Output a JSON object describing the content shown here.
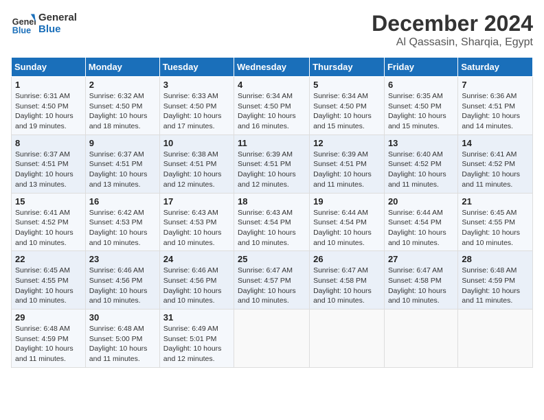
{
  "logo": {
    "line1": "General",
    "line2": "Blue"
  },
  "title": "December 2024",
  "location": "Al Qassasin, Sharqia, Egypt",
  "weekdays": [
    "Sunday",
    "Monday",
    "Tuesday",
    "Wednesday",
    "Thursday",
    "Friday",
    "Saturday"
  ],
  "weeks": [
    [
      {
        "day": "1",
        "info": "Sunrise: 6:31 AM\nSunset: 4:50 PM\nDaylight: 10 hours\nand 19 minutes."
      },
      {
        "day": "2",
        "info": "Sunrise: 6:32 AM\nSunset: 4:50 PM\nDaylight: 10 hours\nand 18 minutes."
      },
      {
        "day": "3",
        "info": "Sunrise: 6:33 AM\nSunset: 4:50 PM\nDaylight: 10 hours\nand 17 minutes."
      },
      {
        "day": "4",
        "info": "Sunrise: 6:34 AM\nSunset: 4:50 PM\nDaylight: 10 hours\nand 16 minutes."
      },
      {
        "day": "5",
        "info": "Sunrise: 6:34 AM\nSunset: 4:50 PM\nDaylight: 10 hours\nand 15 minutes."
      },
      {
        "day": "6",
        "info": "Sunrise: 6:35 AM\nSunset: 4:50 PM\nDaylight: 10 hours\nand 15 minutes."
      },
      {
        "day": "7",
        "info": "Sunrise: 6:36 AM\nSunset: 4:51 PM\nDaylight: 10 hours\nand 14 minutes."
      }
    ],
    [
      {
        "day": "8",
        "info": "Sunrise: 6:37 AM\nSunset: 4:51 PM\nDaylight: 10 hours\nand 13 minutes."
      },
      {
        "day": "9",
        "info": "Sunrise: 6:37 AM\nSunset: 4:51 PM\nDaylight: 10 hours\nand 13 minutes."
      },
      {
        "day": "10",
        "info": "Sunrise: 6:38 AM\nSunset: 4:51 PM\nDaylight: 10 hours\nand 12 minutes."
      },
      {
        "day": "11",
        "info": "Sunrise: 6:39 AM\nSunset: 4:51 PM\nDaylight: 10 hours\nand 12 minutes."
      },
      {
        "day": "12",
        "info": "Sunrise: 6:39 AM\nSunset: 4:51 PM\nDaylight: 10 hours\nand 11 minutes."
      },
      {
        "day": "13",
        "info": "Sunrise: 6:40 AM\nSunset: 4:52 PM\nDaylight: 10 hours\nand 11 minutes."
      },
      {
        "day": "14",
        "info": "Sunrise: 6:41 AM\nSunset: 4:52 PM\nDaylight: 10 hours\nand 11 minutes."
      }
    ],
    [
      {
        "day": "15",
        "info": "Sunrise: 6:41 AM\nSunset: 4:52 PM\nDaylight: 10 hours\nand 10 minutes."
      },
      {
        "day": "16",
        "info": "Sunrise: 6:42 AM\nSunset: 4:53 PM\nDaylight: 10 hours\nand 10 minutes."
      },
      {
        "day": "17",
        "info": "Sunrise: 6:43 AM\nSunset: 4:53 PM\nDaylight: 10 hours\nand 10 minutes."
      },
      {
        "day": "18",
        "info": "Sunrise: 6:43 AM\nSunset: 4:54 PM\nDaylight: 10 hours\nand 10 minutes."
      },
      {
        "day": "19",
        "info": "Sunrise: 6:44 AM\nSunset: 4:54 PM\nDaylight: 10 hours\nand 10 minutes."
      },
      {
        "day": "20",
        "info": "Sunrise: 6:44 AM\nSunset: 4:54 PM\nDaylight: 10 hours\nand 10 minutes."
      },
      {
        "day": "21",
        "info": "Sunrise: 6:45 AM\nSunset: 4:55 PM\nDaylight: 10 hours\nand 10 minutes."
      }
    ],
    [
      {
        "day": "22",
        "info": "Sunrise: 6:45 AM\nSunset: 4:55 PM\nDaylight: 10 hours\nand 10 minutes."
      },
      {
        "day": "23",
        "info": "Sunrise: 6:46 AM\nSunset: 4:56 PM\nDaylight: 10 hours\nand 10 minutes."
      },
      {
        "day": "24",
        "info": "Sunrise: 6:46 AM\nSunset: 4:56 PM\nDaylight: 10 hours\nand 10 minutes."
      },
      {
        "day": "25",
        "info": "Sunrise: 6:47 AM\nSunset: 4:57 PM\nDaylight: 10 hours\nand 10 minutes."
      },
      {
        "day": "26",
        "info": "Sunrise: 6:47 AM\nSunset: 4:58 PM\nDaylight: 10 hours\nand 10 minutes."
      },
      {
        "day": "27",
        "info": "Sunrise: 6:47 AM\nSunset: 4:58 PM\nDaylight: 10 hours\nand 10 minutes."
      },
      {
        "day": "28",
        "info": "Sunrise: 6:48 AM\nSunset: 4:59 PM\nDaylight: 10 hours\nand 11 minutes."
      }
    ],
    [
      {
        "day": "29",
        "info": "Sunrise: 6:48 AM\nSunset: 4:59 PM\nDaylight: 10 hours\nand 11 minutes."
      },
      {
        "day": "30",
        "info": "Sunrise: 6:48 AM\nSunset: 5:00 PM\nDaylight: 10 hours\nand 11 minutes."
      },
      {
        "day": "31",
        "info": "Sunrise: 6:49 AM\nSunset: 5:01 PM\nDaylight: 10 hours\nand 12 minutes."
      },
      {
        "day": "",
        "info": ""
      },
      {
        "day": "",
        "info": ""
      },
      {
        "day": "",
        "info": ""
      },
      {
        "day": "",
        "info": ""
      }
    ]
  ]
}
